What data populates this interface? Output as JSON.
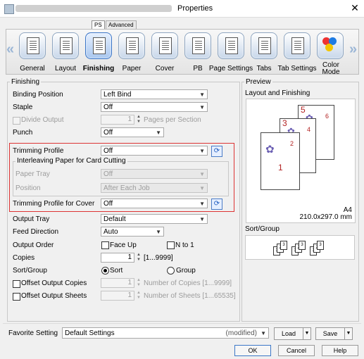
{
  "window": {
    "title": "Properties",
    "close": "✕"
  },
  "tabs": [
    "PS",
    "Advanced"
  ],
  "ribbon": {
    "items": [
      {
        "label": "General"
      },
      {
        "label": "Layout"
      },
      {
        "label": "Finishing"
      },
      {
        "label": "Paper"
      },
      {
        "label": "Cover"
      },
      {
        "label": "PB"
      },
      {
        "label": "Page Settings"
      },
      {
        "label": "Tabs"
      },
      {
        "label": "Tab Settings"
      },
      {
        "label": "Color Mode"
      }
    ],
    "left_arrow": "«",
    "right_arrow": "»"
  },
  "finishing": {
    "group_title": "Finishing",
    "binding_position": {
      "label": "Binding Position",
      "value": "Left Bind"
    },
    "staple": {
      "label": "Staple",
      "value": "Off"
    },
    "divide_output": {
      "label": "Divide Output",
      "value": "1",
      "unit": "Pages per Section"
    },
    "punch": {
      "label": "Punch",
      "value": "Off"
    },
    "trimming_profile": {
      "label": "Trimming Profile",
      "value": "Off"
    },
    "interleaving": {
      "title": "Interleaving Paper for Card Cutting",
      "paper_tray_label": "Paper Tray",
      "paper_tray_value": "Off",
      "position_label": "Position",
      "position_value": "After Each Job"
    },
    "trimming_cover": {
      "label": "Trimming Profile for Cover",
      "value": "Off"
    },
    "output_tray": {
      "label": "Output Tray",
      "value": "Default"
    },
    "feed_direction": {
      "label": "Feed Direction",
      "value": "Auto"
    },
    "output_order": {
      "label": "Output Order",
      "face_up": "Face Up",
      "n_to_1": "N to 1"
    },
    "copies": {
      "label": "Copies",
      "value": "1",
      "range": "[1...9999]"
    },
    "sort_group": {
      "label": "Sort/Group",
      "sort": "Sort",
      "group": "Group"
    },
    "offset_copies": {
      "label": "Offset Output Copies",
      "value": "1",
      "hint": "Number of Copies [1...9999]"
    },
    "offset_sheets": {
      "label": "Offset Output Sheets",
      "value": "1",
      "hint": "Number of Sheets [1...65535]"
    }
  },
  "preview": {
    "group_title": "Preview",
    "layout_title": "Layout and Finishing",
    "paper_size": "A4",
    "paper_dims": "210.0x297.0 mm",
    "page_numbers": [
      "1",
      "2",
      "3",
      "4",
      "5",
      "6"
    ],
    "sort_group_title": "Sort/Group",
    "mini_pages": [
      "1",
      "2",
      "3",
      "1",
      "2",
      "3",
      "1",
      "2",
      "3"
    ]
  },
  "favorite": {
    "label": "Favorite Setting",
    "value": "Default Settings",
    "state": "(modified)",
    "load": "Load",
    "save": "Save"
  },
  "buttons": {
    "ok": "OK",
    "cancel": "Cancel",
    "help": "Help"
  }
}
